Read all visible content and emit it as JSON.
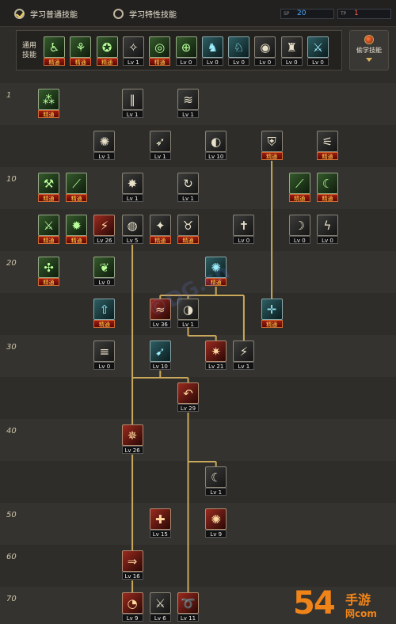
{
  "header": {
    "tab_normal": "学习普通技能",
    "tab_trait": "学习特性技能",
    "sp_label": "SP",
    "sp_value": "20",
    "tp_label": "TP",
    "tp_value": "1"
  },
  "common": {
    "label": "通用技能",
    "skills": [
      {
        "icon": "sitting-figure-icon",
        "glyph": "♿",
        "tag": "精通",
        "kind": "mst",
        "color": "green"
      },
      {
        "icon": "crouch-figure-icon",
        "glyph": "⚘",
        "tag": "精通",
        "kind": "mst",
        "color": "green"
      },
      {
        "icon": "kick-figure-icon",
        "glyph": "✪",
        "tag": "精通",
        "kind": "mst",
        "color": "green"
      },
      {
        "icon": "wings-icon",
        "glyph": "✧",
        "tag": "Lv 1",
        "kind": "lv",
        "color": "dark"
      },
      {
        "icon": "target-icon",
        "glyph": "◎",
        "tag": "精通",
        "kind": "mst",
        "color": "green"
      },
      {
        "icon": "crosshair-icon",
        "glyph": "⊕",
        "tag": "Lv 0",
        "kind": "lv",
        "color": "green"
      },
      {
        "icon": "rider-icon",
        "glyph": "♞",
        "tag": "Lv 0",
        "kind": "lv",
        "color": "teal"
      },
      {
        "icon": "beast-icon",
        "glyph": "♘",
        "tag": "Lv 0",
        "kind": "lv",
        "color": "teal"
      },
      {
        "icon": "spiral-icon",
        "glyph": "◉",
        "tag": "Lv 0",
        "kind": "lv",
        "color": "dark"
      },
      {
        "icon": "warrior-icon",
        "glyph": "♜",
        "tag": "Lv 0",
        "kind": "lv",
        "color": "dark"
      },
      {
        "icon": "figure-icon",
        "glyph": "⚔",
        "tag": "Lv 0",
        "kind": "lv",
        "color": "teal"
      }
    ]
  },
  "advance": {
    "label": "偷学技能",
    "icon": "orb-icon"
  },
  "levels": [
    "1",
    "10",
    "20",
    "30",
    "40",
    "50",
    "60",
    "70"
  ],
  "tree": [
    {
      "col": 1,
      "row": 0,
      "icon": "shards-icon",
      "glyph": "⁂",
      "tag": "精通",
      "kind": "mst",
      "color": "green"
    },
    {
      "col": 4,
      "row": 0,
      "icon": "slash-icon",
      "glyph": "∥",
      "tag": "Lv 1",
      "kind": "lv",
      "color": "dark"
    },
    {
      "col": 6,
      "row": 0,
      "icon": "swipe-icon",
      "glyph": "≋",
      "tag": "Lv 1",
      "kind": "lv",
      "color": "dark"
    },
    {
      "col": 3,
      "row": 1,
      "icon": "claw-icon",
      "glyph": "✺",
      "tag": "Lv 1",
      "kind": "lv",
      "color": "dark"
    },
    {
      "col": 5,
      "row": 1,
      "icon": "arrow-icon",
      "glyph": "➶",
      "tag": "Lv 1",
      "kind": "lv",
      "color": "dark"
    },
    {
      "col": 7,
      "row": 1,
      "icon": "swirl-icon",
      "glyph": "◐",
      "tag": "Lv 10",
      "kind": "lv",
      "color": "dark"
    },
    {
      "col": 9,
      "row": 1,
      "icon": "shield-icon",
      "glyph": "⛨",
      "tag": "精通",
      "kind": "mst",
      "color": "dark"
    },
    {
      "col": 11,
      "row": 1,
      "icon": "triple-blade-icon",
      "glyph": "⚟",
      "tag": "精通",
      "kind": "mst",
      "color": "dark"
    },
    {
      "col": 1,
      "row": 2,
      "icon": "sword-icon",
      "glyph": "⚒",
      "tag": "精通",
      "kind": "mst",
      "color": "green"
    },
    {
      "col": 2,
      "row": 2,
      "icon": "blade-icon",
      "glyph": "⟋",
      "tag": "精通",
      "kind": "mst",
      "color": "green"
    },
    {
      "col": 4,
      "row": 2,
      "icon": "burst-icon",
      "glyph": "✸",
      "tag": "Lv 1",
      "kind": "lv",
      "color": "dark"
    },
    {
      "col": 6,
      "row": 2,
      "icon": "loop-icon",
      "glyph": "↻",
      "tag": "Lv 1",
      "kind": "lv",
      "color": "dark"
    },
    {
      "col": 10,
      "row": 2,
      "icon": "lance-icon",
      "glyph": "⟋",
      "tag": "精通",
      "kind": "mst",
      "color": "green"
    },
    {
      "col": 11,
      "row": 2,
      "icon": "crescent-icon",
      "glyph": "☾",
      "tag": "精通",
      "kind": "mst",
      "color": "green"
    },
    {
      "col": 1,
      "row": 3,
      "icon": "greatsword-icon",
      "glyph": "⚔",
      "tag": "精通",
      "kind": "mst",
      "color": "green"
    },
    {
      "col": 2,
      "row": 3,
      "icon": "spark-icon",
      "glyph": "✹",
      "tag": "精通",
      "kind": "mst",
      "color": "green"
    },
    {
      "col": 3,
      "row": 3,
      "icon": "red-slash-icon",
      "glyph": "⚡",
      "tag": "Lv 26",
      "kind": "lv",
      "color": "red"
    },
    {
      "col": 4,
      "row": 3,
      "icon": "whirl-icon",
      "glyph": "◍",
      "tag": "Lv 5",
      "kind": "lv",
      "color": "dark"
    },
    {
      "col": 5,
      "row": 3,
      "icon": "fighter-icon",
      "glyph": "✦",
      "tag": "精通",
      "kind": "mst",
      "color": "dark"
    },
    {
      "col": 6,
      "row": 3,
      "icon": "horns-icon",
      "glyph": "♉",
      "tag": "精通",
      "kind": "mst",
      "color": "dark"
    },
    {
      "col": 8,
      "row": 3,
      "icon": "dagger-icon",
      "glyph": "✝",
      "tag": "Lv 0",
      "kind": "lv",
      "color": "dark"
    },
    {
      "col": 10,
      "row": 3,
      "icon": "moon-slash-icon",
      "glyph": "☽",
      "tag": "Lv 0",
      "kind": "lv",
      "color": "dark"
    },
    {
      "col": 11,
      "row": 3,
      "icon": "lightning-icon",
      "glyph": "ϟ",
      "tag": "Lv 0",
      "kind": "lv",
      "color": "dark"
    },
    {
      "col": 1,
      "row": 4,
      "icon": "staff-icon",
      "glyph": "✣",
      "tag": "精通",
      "kind": "mst",
      "color": "green"
    },
    {
      "col": 3,
      "row": 4,
      "icon": "leaf-blade-icon",
      "glyph": "❦",
      "tag": "Lv 0",
      "kind": "lv",
      "color": "green"
    },
    {
      "col": 7,
      "row": 4,
      "icon": "aura-icon",
      "glyph": "✺",
      "tag": "精通",
      "kind": "mst",
      "color": "teal"
    },
    {
      "col": 3,
      "row": 5,
      "icon": "up-arrow-icon",
      "glyph": "⇧",
      "tag": "精通",
      "kind": "mst",
      "color": "teal"
    },
    {
      "col": 5,
      "row": 5,
      "icon": "flame-strike-icon",
      "glyph": "≈",
      "tag": "Lv 36",
      "kind": "lv",
      "color": "red"
    },
    {
      "col": 6,
      "row": 5,
      "icon": "crescent-strike-icon",
      "glyph": "◑",
      "tag": "Lv 1",
      "kind": "lv",
      "color": "dark"
    },
    {
      "col": 9,
      "row": 5,
      "icon": "crossblade-icon",
      "glyph": "✛",
      "tag": "精通",
      "kind": "mst",
      "color": "teal"
    },
    {
      "col": 3,
      "row": 6,
      "icon": "bars-icon",
      "glyph": "≡",
      "tag": "Lv 0",
      "kind": "lv",
      "color": "dark"
    },
    {
      "col": 5,
      "row": 6,
      "icon": "dash-icon",
      "glyph": "➹",
      "tag": "Lv 10",
      "kind": "lv",
      "color": "teal"
    },
    {
      "col": 7,
      "row": 6,
      "icon": "flow-icon",
      "glyph": "✷",
      "tag": "Lv 21",
      "kind": "lv",
      "color": "red"
    },
    {
      "col": 8,
      "row": 6,
      "icon": "flow-slash-icon",
      "glyph": "⚡",
      "tag": "Lv 1",
      "kind": "lv",
      "color": "dark"
    },
    {
      "col": 6,
      "row": 7,
      "icon": "hook-icon",
      "glyph": "↶",
      "tag": "Lv 29",
      "kind": "lv",
      "color": "red"
    },
    {
      "col": 4,
      "row": 8,
      "icon": "dragon-icon",
      "glyph": "✵",
      "tag": "Lv 26",
      "kind": "lv",
      "color": "red"
    },
    {
      "col": 7,
      "row": 9,
      "icon": "arc-slash-icon",
      "glyph": "☾",
      "tag": "Lv 1",
      "kind": "lv",
      "color": "dark"
    },
    {
      "col": 5,
      "row": 10,
      "icon": "figure-strike-icon",
      "glyph": "✚",
      "tag": "Lv 15",
      "kind": "lv",
      "color": "red"
    },
    {
      "col": 7,
      "row": 10,
      "icon": "blood-burst-icon",
      "glyph": "✺",
      "tag": "Lv 9",
      "kind": "lv",
      "color": "red"
    },
    {
      "col": 4,
      "row": 11,
      "icon": "fire-slash-icon",
      "glyph": "⇒",
      "tag": "Lv 16",
      "kind": "lv",
      "color": "red"
    },
    {
      "col": 4,
      "row": 12,
      "icon": "circle-slash-icon",
      "glyph": "◔",
      "tag": "Lv 9",
      "kind": "lv",
      "color": "red"
    },
    {
      "col": 5,
      "row": 12,
      "icon": "multi-blade-icon",
      "glyph": "⚔",
      "tag": "Lv 6",
      "kind": "lv",
      "color": "dark"
    },
    {
      "col": 6,
      "row": 12,
      "icon": "spin-slash-icon",
      "glyph": "➰",
      "tag": "Lv 11",
      "kind": "lv",
      "color": "red"
    }
  ],
  "watermark": {
    "center": "©DG.cn",
    "logo_num": "54",
    "logo_top": "手游",
    "logo_bot": "网com"
  }
}
